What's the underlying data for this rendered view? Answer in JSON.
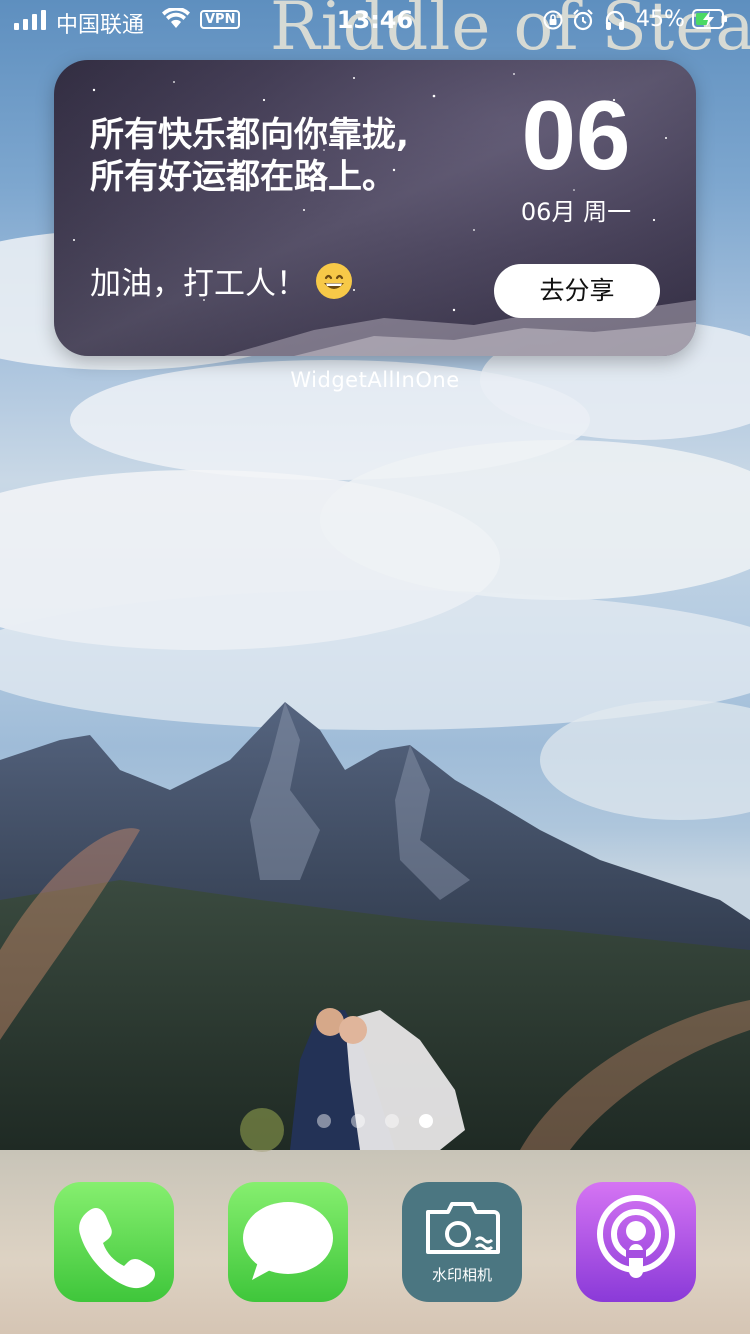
{
  "status_bar": {
    "carrier": "中国联通",
    "vpn_label": "VPN",
    "time": "13:46",
    "battery_percent": "45%",
    "icons": [
      "signal-icon",
      "wifi-icon",
      "rotation-lock-icon",
      "alarm-icon",
      "headphones-icon",
      "battery-charging-icon"
    ]
  },
  "wallpaper": {
    "overlay_text": "Riddle of Stea"
  },
  "widget": {
    "quote_line1": "所有快乐都向你靠拢,",
    "quote_line2": "所有好运都在路上。",
    "cheer_text": "加油，打工人！",
    "emoji_icon": "grinning-face-icon",
    "day": "06",
    "date_text": "06月 周一",
    "share_button": "去分享",
    "caption": "WidgetAllInOne"
  },
  "page_indicator": {
    "count": 4,
    "active_index": 3
  },
  "dock": {
    "apps": [
      {
        "name": "phone",
        "icon": "phone-icon"
      },
      {
        "name": "messages",
        "icon": "message-bubble-icon"
      },
      {
        "name": "watermark-camera",
        "icon": "camera-icon",
        "label": "水印相机"
      },
      {
        "name": "podcasts",
        "icon": "podcasts-icon"
      }
    ]
  }
}
